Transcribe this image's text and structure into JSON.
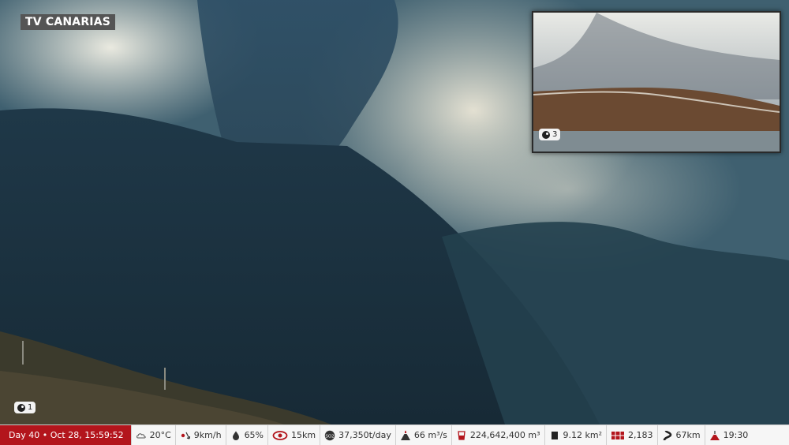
{
  "channel": {
    "name": "TV CANARIAS"
  },
  "main_camera": {
    "label": "1"
  },
  "inset_camera": {
    "label": "3"
  },
  "status": {
    "day": "Day 40 • Oct 28, 15:59:52",
    "temperature": "20°C",
    "wind": "9km/h",
    "humidity": "65%",
    "visibility": "15km",
    "so2": "37,350t/day",
    "lava_flow": "66 m³/s",
    "volume": "224,642,400 m³",
    "area": "9.12 km²",
    "buildings": "2,183",
    "road": "67km",
    "time": "19:30"
  },
  "colors": {
    "day_badge": "#b3151c",
    "statusbar_bg": "#f6f6f6",
    "brand_bg": "#555555"
  },
  "icons": [
    "cloud-icon",
    "wind-icon",
    "humidity-drop-icon",
    "eye-icon",
    "so2-icon",
    "volcano-icon",
    "flow-cup-icon",
    "volume-block-icon",
    "area-grid-icon",
    "road-icon",
    "volcano-time-icon"
  ]
}
